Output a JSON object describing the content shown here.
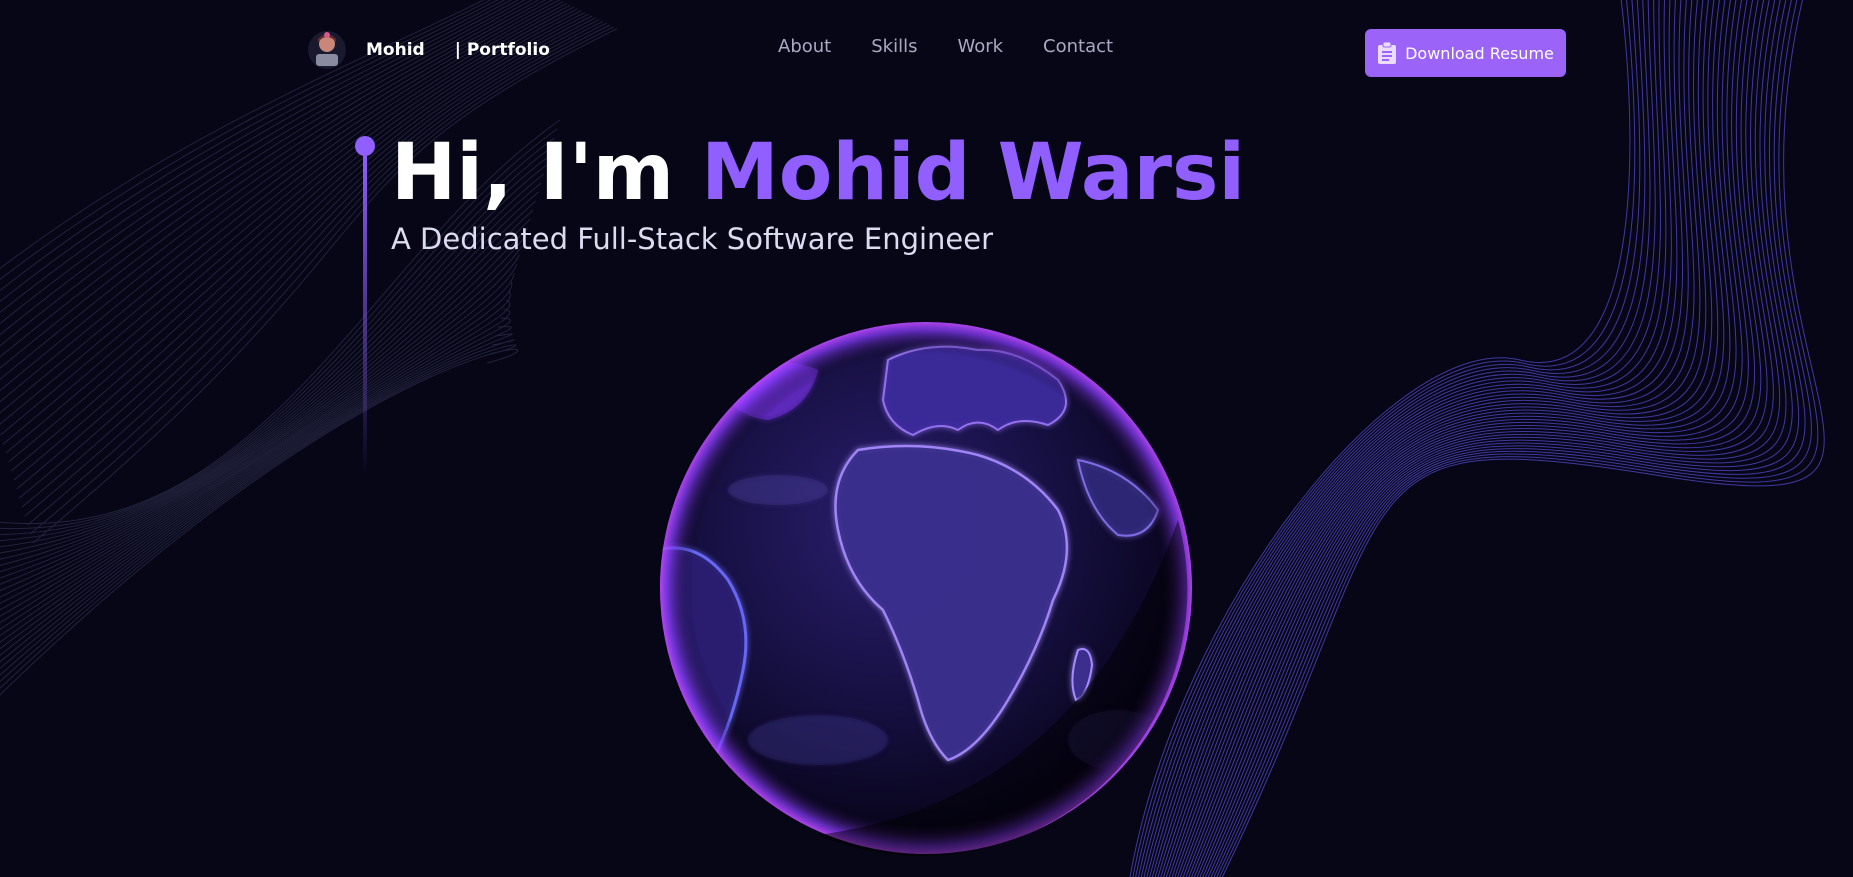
{
  "brand": {
    "name": "Mohid",
    "separator_text": "| Portfolio",
    "avatar_icon": "avatar-icon"
  },
  "nav": {
    "links": [
      {
        "label": "About"
      },
      {
        "label": "Skills"
      },
      {
        "label": "Work"
      },
      {
        "label": "Contact"
      }
    ]
  },
  "resume_button": {
    "label": "Download Resume",
    "icon": "clipboard-icon"
  },
  "hero": {
    "greeting": "Hi, I'm ",
    "name": "Mohid Warsi",
    "subtitle": "A Dedicated Full-Stack Software Engineer"
  },
  "globe": {
    "icon": "earth-globe"
  },
  "colors": {
    "background": "#060617",
    "accent": "#915eff",
    "button": "#9b63f8",
    "nav_text": "#a9a9c2"
  }
}
